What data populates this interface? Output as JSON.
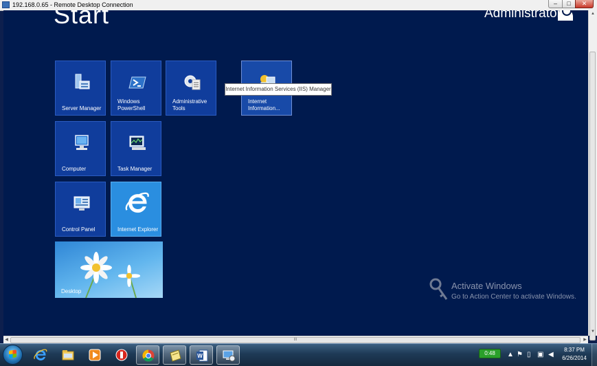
{
  "window": {
    "title": "192.168.0.65 - Remote Desktop Connection",
    "minimize": "–",
    "maximize": "□",
    "close": "✕"
  },
  "start": {
    "title": "Start",
    "user": "Administrator"
  },
  "tiles": [
    {
      "id": "server-manager",
      "label": "Server Manager",
      "icon": "server-manager-icon"
    },
    {
      "id": "windows-powershell",
      "label": "Windows\nPowerShell",
      "icon": "powershell-icon"
    },
    {
      "id": "administrative-tools",
      "label": "Administrative\nTools",
      "icon": "admin-tools-icon"
    },
    {
      "id": "iis-manager",
      "label": "Internet\nInformation...",
      "icon": "iis-icon"
    },
    {
      "id": "computer",
      "label": "Computer",
      "icon": "computer-icon"
    },
    {
      "id": "task-manager",
      "label": "Task Manager",
      "icon": "task-manager-icon"
    },
    {
      "id": "control-panel",
      "label": "Control Panel",
      "icon": "control-panel-icon"
    },
    {
      "id": "internet-explorer",
      "label": "Internet Explorer",
      "icon": "ie-icon"
    },
    {
      "id": "desktop",
      "label": "Desktop",
      "icon": "desktop-wallpaper"
    }
  ],
  "tooltip": "Internet Information Services (IIS) Manager",
  "watermark": {
    "title": "Activate Windows",
    "subtitle": "Go to Action Center to activate Windows."
  },
  "scroll": {
    "h_grip": "III",
    "v_grip": "≡"
  },
  "taskbar": {
    "apps": [
      "internet-explorer",
      "file-explorer",
      "media-player",
      "app-red",
      "chrome",
      "notes",
      "word",
      "remote-desktop"
    ],
    "battery": "0:48",
    "time": "8:37 PM",
    "date": "6/26/2014"
  },
  "colors": {
    "start_bg": "#001a4e",
    "tile": "#103d9c",
    "ie_tile": "#2a8ee0"
  }
}
